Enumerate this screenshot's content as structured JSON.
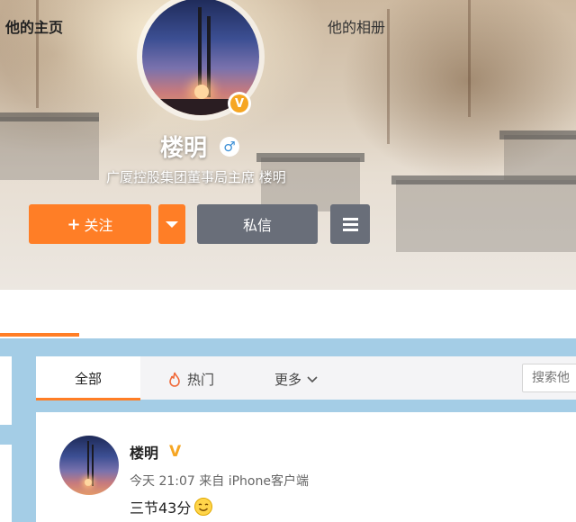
{
  "profile": {
    "name": "楼明",
    "verified_badge": "V",
    "gender_icon": "male-icon",
    "description": "广厦控股集团董事局主席 楼明"
  },
  "actions": {
    "follow_plus": "+",
    "follow_label": "关注",
    "message_label": "私信"
  },
  "tabs": {
    "home": "他的主页",
    "album": "他的相册"
  },
  "filter": {
    "all": "全部",
    "hot": "热门",
    "more": "更多",
    "search_placeholder": "搜索他"
  },
  "post": {
    "author": "楼明",
    "vip_badge": "V",
    "meta": "今天 21:07 来自 iPhone客户端",
    "text": "三节43分"
  },
  "colors": {
    "accent": "#ff7e26",
    "button_gray": "#696e79",
    "main_bg": "#a4cde6",
    "verified": "#f6a623"
  }
}
